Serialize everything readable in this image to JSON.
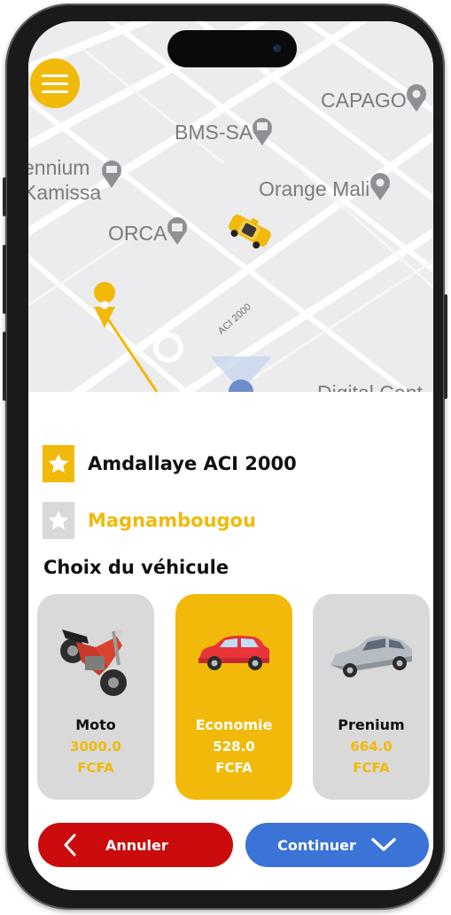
{
  "map": {
    "pois": [
      "CAPAGO",
      "BMS-SA",
      "ennium",
      "Kamissa",
      "Orange Mali",
      "ORCA",
      "Digital Cent"
    ],
    "road_label": "ACI 2000",
    "menu_icon": "hamburger-menu-icon",
    "taxi_icon": "taxi-icon",
    "origin_pin_icon": "location-pin-icon"
  },
  "addresses": [
    {
      "label": "Amdallaye ACI 2000",
      "icon": "star-icon",
      "color": "#111111",
      "icon_color": "#f1ba0a"
    },
    {
      "label": "Magnambougou",
      "icon": "star-icon",
      "color": "#f1ba0a",
      "icon_color": "#d9d9d9"
    }
  ],
  "vehicle_section_title": "Choix du véhicule",
  "vehicles": [
    {
      "name": "Moto",
      "price": "3000.0",
      "currency": "FCFA",
      "selected": false
    },
    {
      "name": "Economie",
      "price": "528.0",
      "currency": "FCFA",
      "selected": true
    },
    {
      "name": "Prenium",
      "price": "664.0",
      "currency": "FCFA",
      "selected": false
    }
  ],
  "actions": {
    "cancel_label": "Annuler",
    "continue_label": "Continuer"
  },
  "colors": {
    "accent": "#f1ba0a",
    "cancel": "#cc0c0c",
    "continue": "#3b73d6"
  }
}
